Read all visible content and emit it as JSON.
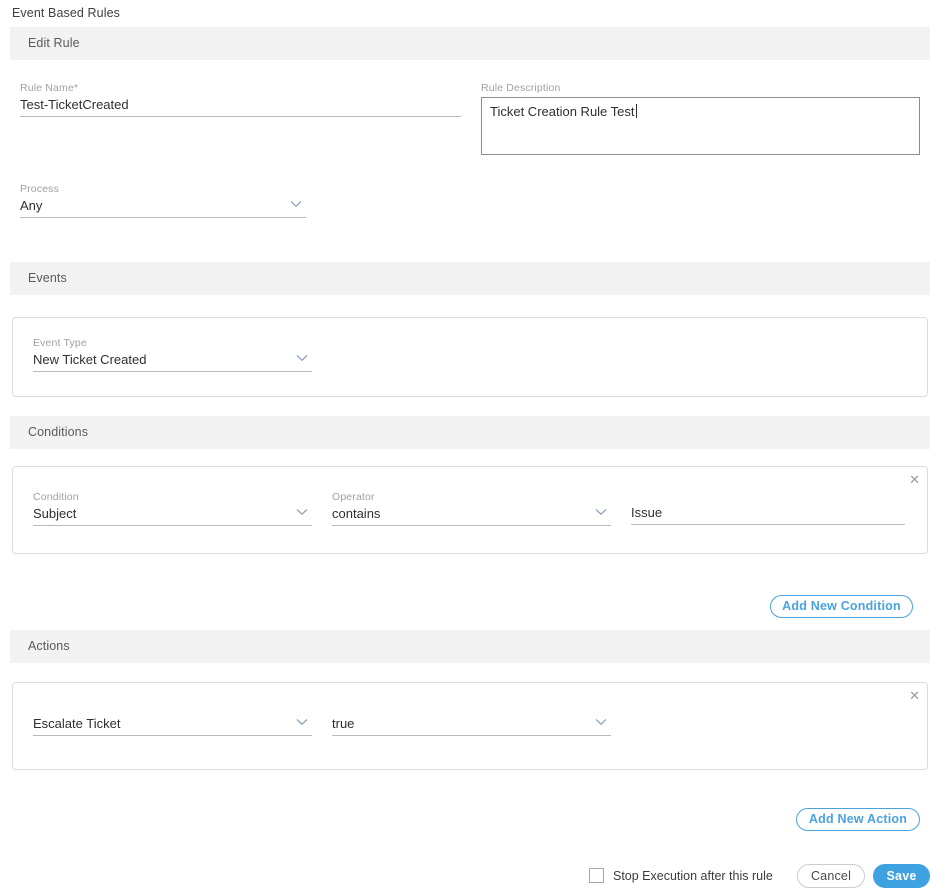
{
  "page": {
    "title": "Event Based Rules"
  },
  "sections": {
    "edit_rule": "Edit Rule",
    "events": "Events",
    "conditions": "Conditions",
    "actions": "Actions"
  },
  "rule": {
    "name_label": "Rule Name*",
    "name_value": "Test-TicketCreated",
    "name_placeholder": "",
    "description_label": "Rule Description",
    "description_value": "Ticket Creation Rule Test",
    "description_placeholder": "",
    "process_label": "Process",
    "process_value": "Any"
  },
  "events": {
    "event_type_label": "Event Type",
    "event_type_value": "New Ticket Created"
  },
  "conditions": {
    "rows": [
      {
        "condition_label": "Condition",
        "condition_value": "Subject",
        "operator_label": "Operator",
        "operator_value": "contains",
        "value_label": "",
        "value_value": "Issue",
        "remove_icon": "close-icon"
      }
    ],
    "add_button": "Add New Condition"
  },
  "actions": {
    "rows": [
      {
        "action_value": "Escalate Ticket",
        "param_value": "true",
        "remove_icon": "close-icon"
      }
    ],
    "add_button": "Add New Action"
  },
  "footer": {
    "stop_execution_label": "Stop Execution after this rule",
    "stop_execution_checked": false,
    "cancel_label": "Cancel",
    "save_label": "Save"
  },
  "colors": {
    "accent_blue": "#3fa2e0",
    "outline_blue": "#4aa3df",
    "section_bar": "#f2f2f2",
    "label_gray": "#a0a0a0",
    "underline_gray": "#b9b9b9"
  }
}
